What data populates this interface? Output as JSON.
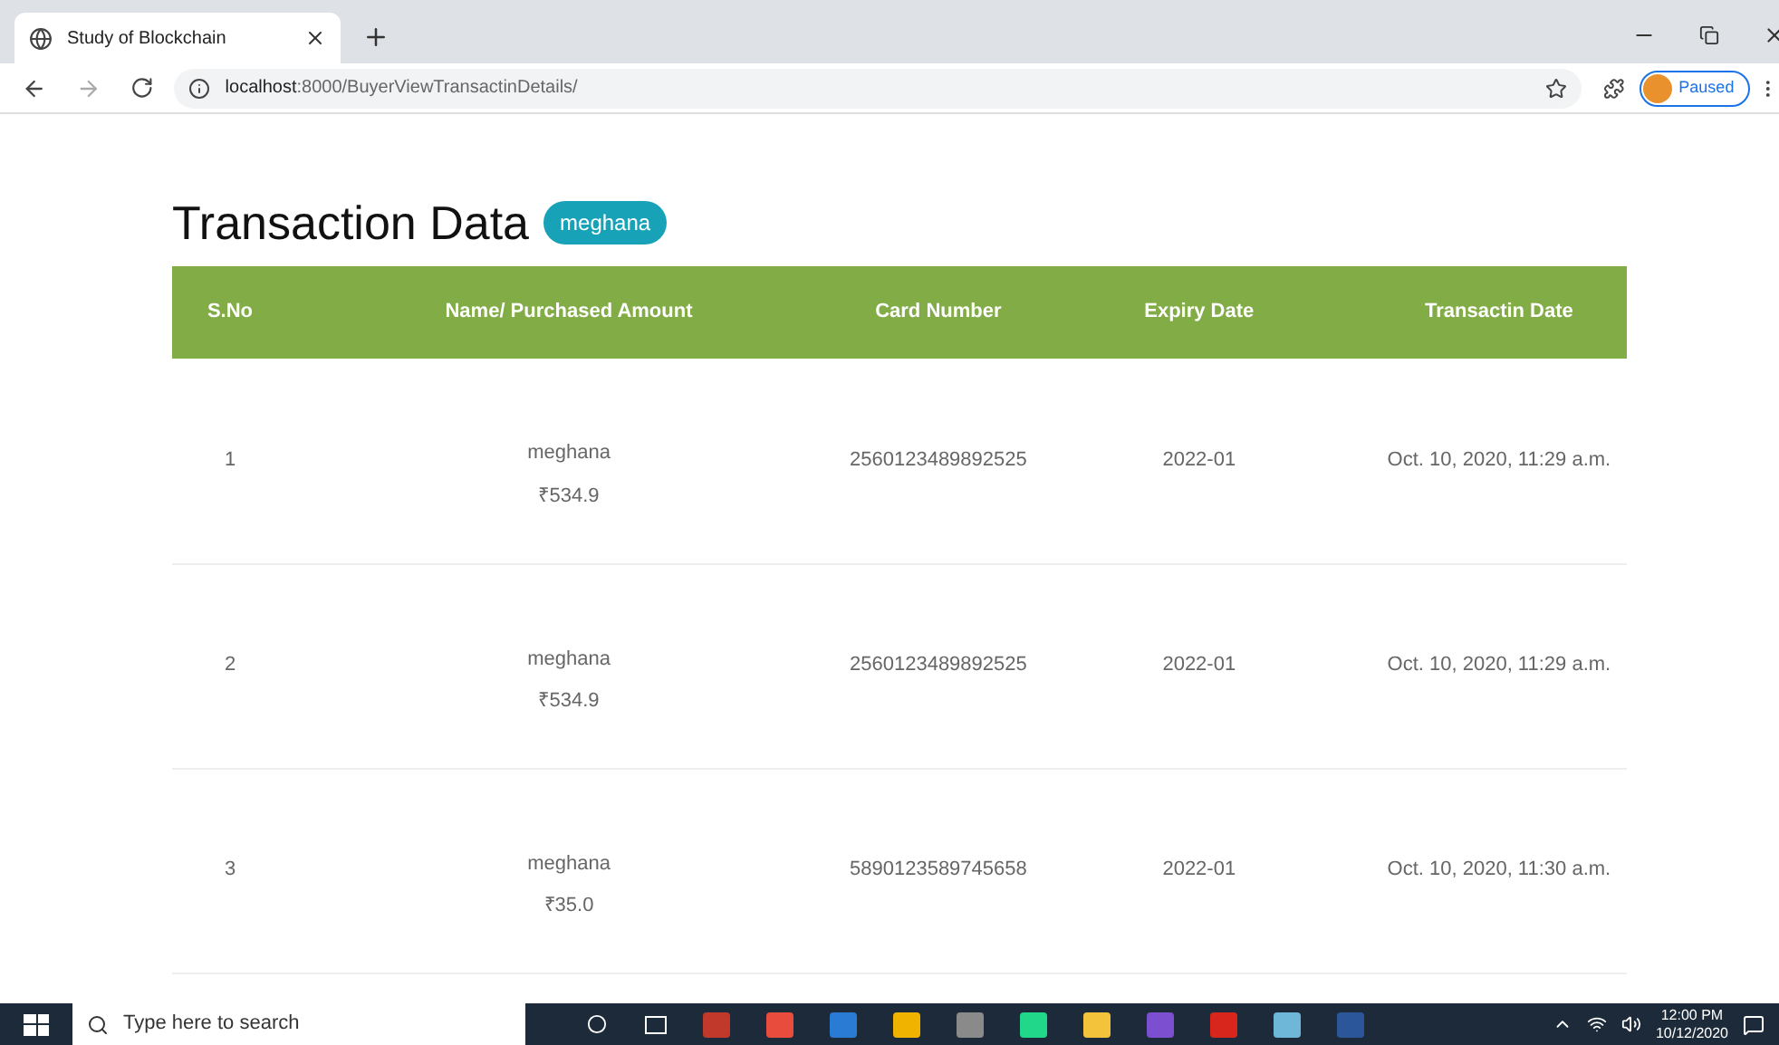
{
  "browser": {
    "tab_title": "Study of Blockchain",
    "url_host": "localhost",
    "url_rest": ":8000/BuyerViewTransactinDetails/",
    "profile_status": "Paused"
  },
  "page": {
    "title": "Transaction Data",
    "user_badge": "meghana"
  },
  "table": {
    "columns": [
      "S.No",
      "Name/ Purchased Amount",
      "Card Number",
      "Expiry Date",
      "Transactin Date"
    ],
    "rows": [
      {
        "sno": "1",
        "name": "meghana",
        "amount": "₹534.9",
        "card": "2560123489892525",
        "expiry": "2022-01",
        "date": "Oct. 10, 2020, 11:29 a.m."
      },
      {
        "sno": "2",
        "name": "meghana",
        "amount": "₹534.9",
        "card": "2560123489892525",
        "expiry": "2022-01",
        "date": "Oct. 10, 2020, 11:29 a.m."
      },
      {
        "sno": "3",
        "name": "meghana",
        "amount": "₹35.0",
        "card": "5890123589745658",
        "expiry": "2022-01",
        "date": "Oct. 10, 2020, 11:30 a.m."
      }
    ]
  },
  "taskbar": {
    "search_placeholder": "Type here to search",
    "time": "12:00 PM",
    "date": "10/12/2020"
  }
}
